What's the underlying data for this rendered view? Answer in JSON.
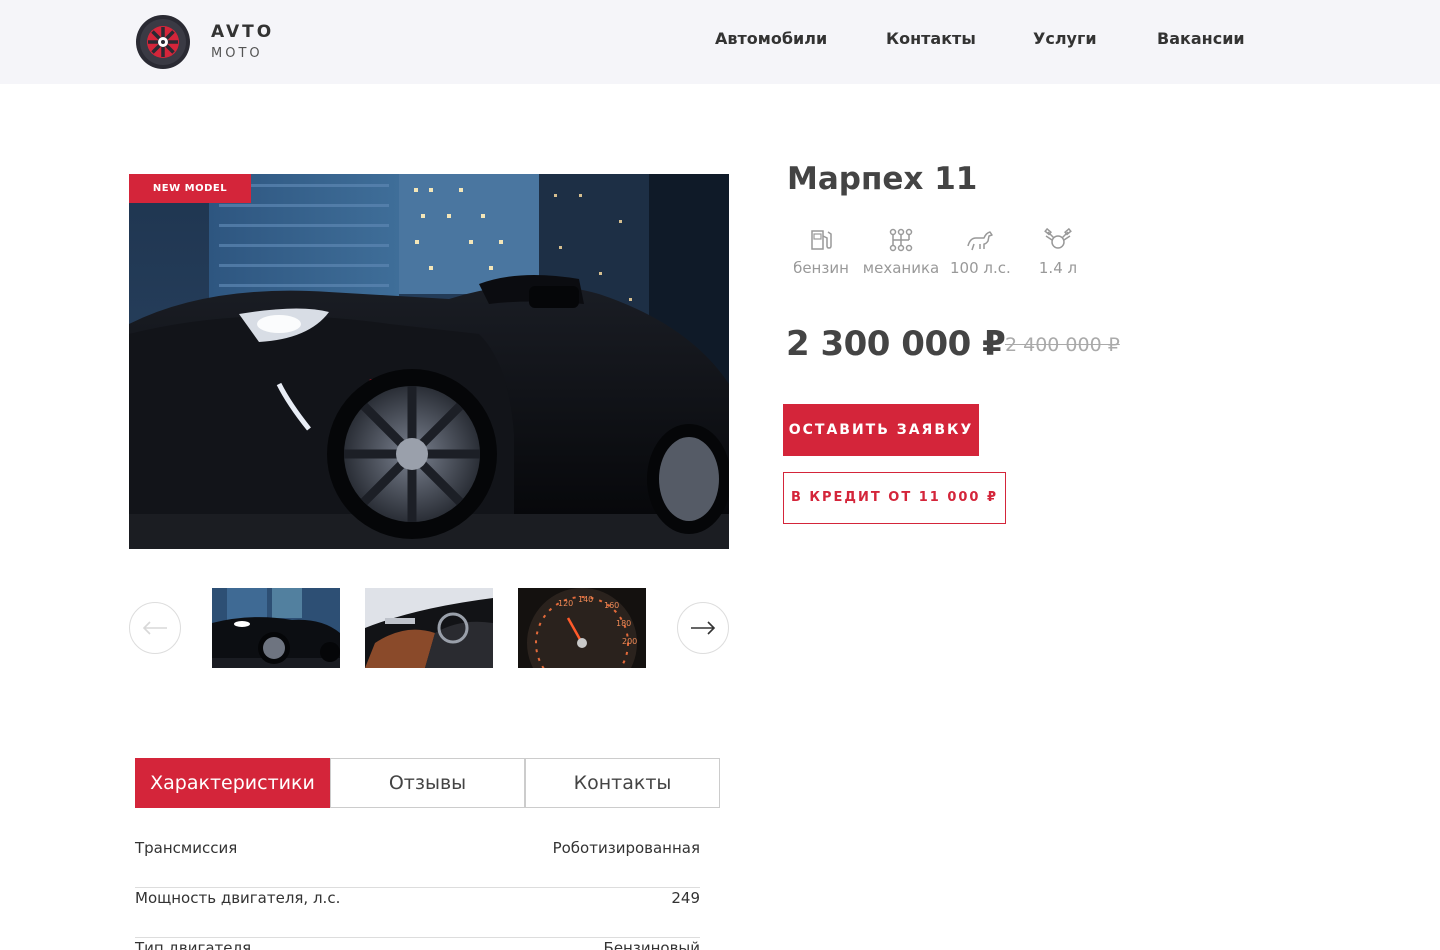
{
  "brand": {
    "name_top": "AVTO",
    "name_bottom": "MOTO",
    "accent": "#d4253a"
  },
  "nav": {
    "items": [
      {
        "label": "Автомобили"
      },
      {
        "label": "Контакты"
      },
      {
        "label": "Услуги"
      },
      {
        "label": "Вакансии"
      }
    ]
  },
  "product": {
    "badge": "NEW MODEL",
    "title": "Марпех 11",
    "specs": [
      {
        "icon": "fuel-pump-icon",
        "label": "бензин"
      },
      {
        "icon": "gearbox-icon",
        "label": "механика"
      },
      {
        "icon": "horse-icon",
        "label": "100 л.с."
      },
      {
        "icon": "engine-icon",
        "label": "1.4 л"
      }
    ],
    "price": "2 300 000 ₽",
    "old_price": "2 400 000 ₽",
    "cta_primary": "ОСТАВИТЬ ЗАЯВКУ",
    "cta_credit": "В КРЕДИТ ОТ 11 000 ₽"
  },
  "gallery": {
    "prev_icon": "arrow-left-icon",
    "next_icon": "arrow-right-icon",
    "thumbs": [
      {
        "subject": "car-exterior"
      },
      {
        "subject": "car-interior"
      },
      {
        "subject": "speedometer"
      }
    ]
  },
  "tabs": [
    {
      "label": "Характеристики",
      "active": true
    },
    {
      "label": "Отзывы",
      "active": false
    },
    {
      "label": "Контакты",
      "active": false
    }
  ],
  "characteristics": [
    {
      "key": "Трансмиссия",
      "value": "Роботизированная"
    },
    {
      "key": "Мощность двигателя, л.с.",
      "value": "249"
    },
    {
      "key": "Тип двигателя",
      "value": "Бензиновый"
    }
  ]
}
